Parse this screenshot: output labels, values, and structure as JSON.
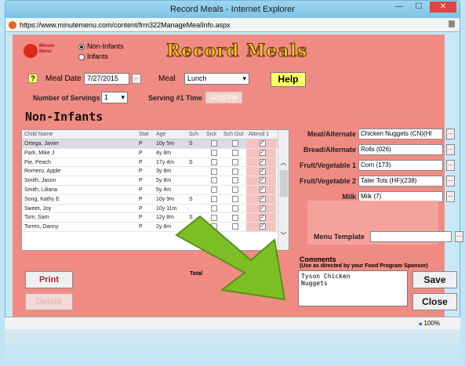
{
  "window": {
    "title": "Record Meals - Internet Explorer",
    "url": "https://www.minutemenu.com/content/frm322ManageMealInfo.aspx"
  },
  "brand": {
    "line1": "Minute",
    "line2": "Menu"
  },
  "audience": {
    "options": [
      "Non-Infants",
      "Infants"
    ],
    "selected": "Non-Infants"
  },
  "page_title": "Record Meals",
  "form": {
    "meal_date_label": "Meal Date",
    "meal_date": "7/27/2015",
    "calendar_btn": "...",
    "meal_label": "Meal",
    "meal": "Lunch",
    "servings_label": "Number of Servings",
    "servings": "1",
    "serving_time_label": "Serving #1 Time",
    "serving_time": "12:10 PM",
    "help": "Help",
    "question": "?"
  },
  "section_title": "Non-Infants",
  "table": {
    "headers": [
      "Child Name",
      "Stat",
      "Age",
      "Sch",
      "Sick",
      "Sch Out",
      "Attend 1"
    ],
    "rows": [
      {
        "name": "Ortega, Javier",
        "stat": "P",
        "age": "10y 5m",
        "sch": "S",
        "attend": "✓"
      },
      {
        "name": "Park, Mike J",
        "stat": "P",
        "age": "4y 8m",
        "sch": "",
        "attend": "✓"
      },
      {
        "name": "Pie, Peach",
        "stat": "P",
        "age": "17y 4m",
        "sch": "S",
        "attend": "✓"
      },
      {
        "name": "Romero, Apple",
        "stat": "P",
        "age": "3y 8m",
        "sch": "",
        "attend": "✓"
      },
      {
        "name": "Smith, Jason",
        "stat": "P",
        "age": "5y 8m",
        "sch": "",
        "attend": "✓"
      },
      {
        "name": "Smith, Liliana",
        "stat": "P",
        "age": "5y 4m",
        "sch": "",
        "attend": "✓"
      },
      {
        "name": "Song, Kathy E",
        "stat": "P",
        "age": "10y 9m",
        "sch": "S",
        "attend": "✓"
      },
      {
        "name": "Sweet, Joy",
        "stat": "P",
        "age": "10y 11m",
        "sch": "",
        "attend": "✓"
      },
      {
        "name": "Tom, Sam",
        "stat": "P",
        "age": "12y 8m",
        "sch": "S",
        "attend": "✓"
      },
      {
        "name": "Torres, Danny",
        "stat": "P",
        "age": "2y 8m",
        "sch": "",
        "attend": "✓"
      }
    ]
  },
  "fields": [
    {
      "label": "Meat/Alternate",
      "value": "Chicken Nuggets (CN)(HI"
    },
    {
      "label": "Bread/Alternate",
      "value": "Rolls (026)"
    },
    {
      "label": "Fruit/Vegetable 1",
      "value": "Corn (173)"
    },
    {
      "label": "Fruit/Vegetable 2",
      "value": "Tater Tots (HF)(238)"
    },
    {
      "label": "Milk",
      "value": "Milk (7)"
    }
  ],
  "menu_template_label": "Menu Template",
  "ellipsis": "...",
  "comments": {
    "label": "Comments",
    "hint": "(Use as directed by your Food Program Sponsor)",
    "text": "Tyson Chicken\nNuggets"
  },
  "total_label": "Total",
  "buttons": {
    "print": "Print",
    "delete": "Delete",
    "save": "Save",
    "close": "Close"
  },
  "status": {
    "zoom": "100%"
  },
  "colors": {
    "panel": "#f08b84",
    "help": "#ffff66",
    "arrow": "#7bbf25"
  }
}
